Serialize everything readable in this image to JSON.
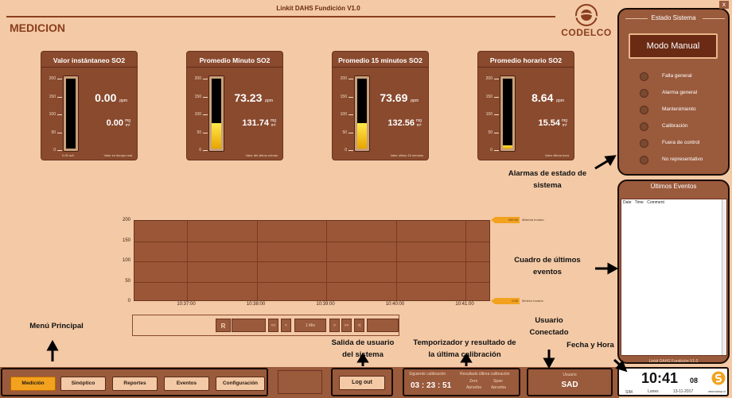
{
  "window": {
    "title": "Linkit DAHS Fundición V1.0",
    "close": "x"
  },
  "page": {
    "title": "MEDICION"
  },
  "logo": {
    "name": "CODELCO"
  },
  "scale_ticks": [
    "200",
    "150",
    "100",
    "50",
    "0"
  ],
  "gauges": [
    {
      "title": "Valor instántaneo SO2",
      "ppm": "0.00",
      "mg": "0.00",
      "level": 0.0,
      "foot_left": "0.00 mA",
      "foot": "Valor en tiempo real"
    },
    {
      "title": "Promedio Minuto SO2",
      "ppm": "73.23",
      "mg": "131.74",
      "level": 0.366,
      "foot_left": "",
      "foot": "Valor del último minuto"
    },
    {
      "title": "Promedio 15 minutos SO2",
      "ppm": "73.69",
      "mg": "132.56",
      "level": 0.368,
      "foot_left": "",
      "foot": "Valor último 15 minutos"
    },
    {
      "title": "Promedio horario SO2",
      "ppm": "8.64",
      "mg": "15.54",
      "level": 0.043,
      "foot_left": "",
      "foot": "Valor última hora"
    }
  ],
  "units": {
    "ppm": "ppm",
    "mg_top": "mg",
    "mg_bot": "m³"
  },
  "chart_data": {
    "type": "line",
    "x": [
      "10:37:00",
      "10:38:00",
      "10:39:00",
      "10:40:00",
      "10:41:00"
    ],
    "y_ticks": [
      "200",
      "150",
      "100",
      "50",
      "0"
    ],
    "ylim": [
      0,
      200
    ],
    "series": [],
    "markers": [
      {
        "value": "200.00",
        "label": "Máxima horario"
      },
      {
        "value": "0.00",
        "label": "Mínimo horario"
      }
    ]
  },
  "controls": {
    "r": "R",
    "first": "<<",
    "prev": "<",
    "interval": "1 Min",
    "next": ">",
    "next2": ">>",
    "last": ">|"
  },
  "system_state": {
    "title": "Estado Sistema",
    "mode": "Modo Manual",
    "alarms": [
      "Falla general",
      "Alarma general",
      "Mantenimiento",
      "Calibración",
      "Fuera de control",
      "No representativo"
    ]
  },
  "events": {
    "title": "Últimos Eventos",
    "columns": [
      "Date",
      "Time",
      "Comment"
    ],
    "footer": "Linkit DAHS Fundición V1.0"
  },
  "menu": [
    "Medición",
    "Sinóptico",
    "Reportes",
    "Eventos",
    "Configuración"
  ],
  "logout": "Log out",
  "calibration": {
    "next_label": "Siguiente calibración",
    "timer": "03 : 23 : 51",
    "result_label": "Resultado última calibración",
    "zero": "Zero",
    "span": "Span",
    "zero_val": "Aprueba",
    "span_val": "Aprueba"
  },
  "user": {
    "label": "Usuario",
    "name": "SAD"
  },
  "datetime": {
    "hm": "10:41",
    "sec": "08",
    "sim": "SIM",
    "day": "Lunes",
    "date": "13-11-2017",
    "brand": "www.siasop.cl"
  },
  "annotations": {
    "alarms": "Alarmas de estado de sistema",
    "events": "Cuadro de últimos eventos",
    "user": "Usuario Conectado",
    "datetime": "Fecha y Hora",
    "menu": "Menú Principal",
    "logout": "Salida de usuario del sistema",
    "calibration": "Temporizador y resultado de la última calibración"
  }
}
